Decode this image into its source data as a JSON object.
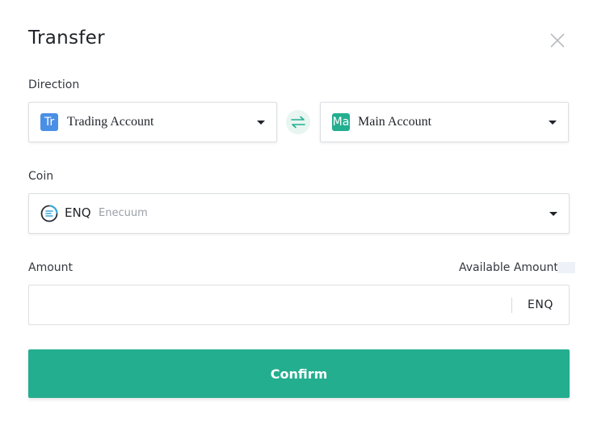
{
  "dialog": {
    "title": "Transfer"
  },
  "direction": {
    "label": "Direction",
    "from": {
      "badge": "Tr",
      "name": "Trading Account",
      "badge_color": "#4a8fe6"
    },
    "to": {
      "badge": "Ma",
      "name": "Main Account",
      "badge_color": "#23ae8f"
    }
  },
  "coin": {
    "label": "Coin",
    "symbol": "ENQ",
    "name": "Enecuum"
  },
  "amount": {
    "label": "Amount",
    "available_label": "Available Amount:",
    "value": "",
    "placeholder": "",
    "unit": "ENQ"
  },
  "actions": {
    "confirm_label": "Confirm"
  },
  "colors": {
    "accent": "#23ae8f",
    "swap_bg": "#e8f5f1"
  }
}
